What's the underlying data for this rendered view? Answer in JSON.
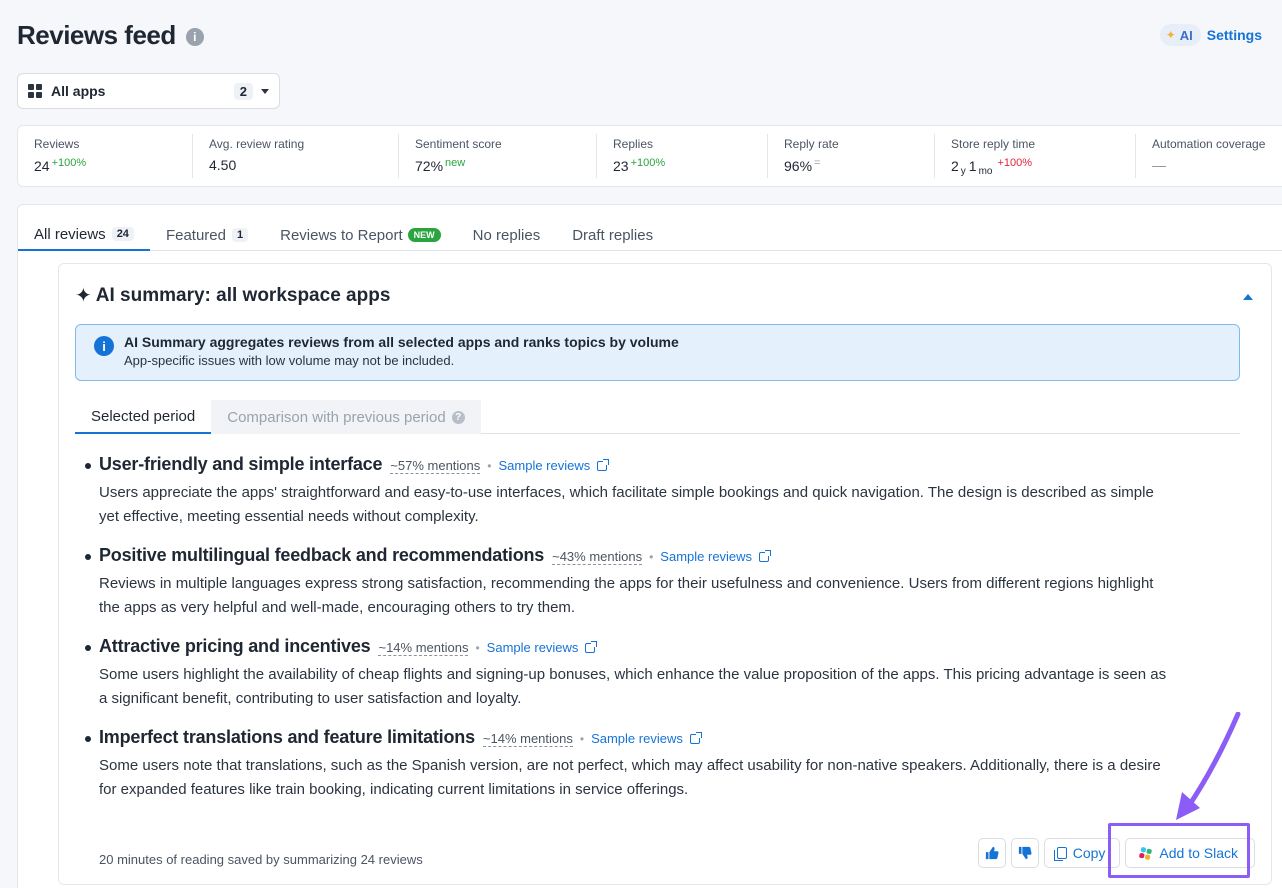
{
  "header": {
    "title": "Reviews feed",
    "info_glyph": "i",
    "ai_label": "AI",
    "settings_label": "Settings"
  },
  "app_select": {
    "label": "All apps",
    "count": "2"
  },
  "stats": [
    {
      "label": "Reviews",
      "value": "24",
      "delta": "+100%",
      "delta_color": "green"
    },
    {
      "label": "Avg. review rating",
      "value": "4.50",
      "delta": "",
      "delta_color": ""
    },
    {
      "label": "Sentiment score",
      "value": "72%",
      "delta": "new",
      "delta_color": "green"
    },
    {
      "label": "Replies",
      "value": "23",
      "delta": "+100%",
      "delta_color": "green"
    },
    {
      "label": "Reply rate",
      "value": "96%",
      "delta": "=",
      "delta_color": "gray"
    },
    {
      "label": "Store reply time",
      "value_parts": [
        "2",
        "y",
        "1",
        "mo"
      ],
      "delta": "+100%",
      "delta_color": "red"
    },
    {
      "label": "Automation coverage",
      "value": "—",
      "delta": "",
      "delta_color": ""
    }
  ],
  "tabs": [
    {
      "label": "All reviews",
      "badge": "24"
    },
    {
      "label": "Featured",
      "badge": "1"
    },
    {
      "label": "Reviews to Report",
      "new_badge": "NEW"
    },
    {
      "label": "No replies"
    },
    {
      "label": "Draft replies"
    }
  ],
  "ai_summary": {
    "title": "AI summary: all workspace apps",
    "notice_title": "AI Summary aggregates reviews from all selected apps and ranks topics by volume",
    "notice_sub": "App-specific issues with low volume may not be included.",
    "sub_tabs": [
      "Selected period",
      "Comparison with previous period"
    ],
    "sample_label": "Sample reviews",
    "topics": [
      {
        "title": "User-friendly and simple interface",
        "mentions": "~57% mentions",
        "body": "Users appreciate the apps' straightforward and easy-to-use interfaces, which facilitate simple bookings and quick navigation. The design is described as simple yet effective, meeting essential needs without complexity."
      },
      {
        "title": "Positive multilingual feedback and recommendations",
        "mentions": "~43% mentions",
        "body": "Reviews in multiple languages express strong satisfaction, recommending the apps for their usefulness and convenience. Users from different regions highlight the apps as very helpful and well-made, encouraging others to try them."
      },
      {
        "title": "Attractive pricing and incentives",
        "mentions": "~14% mentions",
        "body": "Some users highlight the availability of cheap flights and signing-up bonuses, which enhance the value proposition of the apps. This pricing advantage is seen as a significant benefit, contributing to user satisfaction and loyalty."
      },
      {
        "title": "Imperfect translations and feature limitations",
        "mentions": "~14% mentions",
        "body": "Some users note that translations, such as the Spanish version, are not perfect, which may affect usability for non-native speakers. Additionally, there is a desire for expanded features like train booking, indicating current limitations in service offerings."
      }
    ],
    "footer_note": "20 minutes of reading saved by summarizing 24 reviews",
    "copy_label": "Copy",
    "slack_label": "Add to Slack"
  },
  "colors": {
    "accent": "#1673d6",
    "positive": "#2aa43f",
    "negative": "#e0243a",
    "highlight": "#8b5cf6"
  }
}
